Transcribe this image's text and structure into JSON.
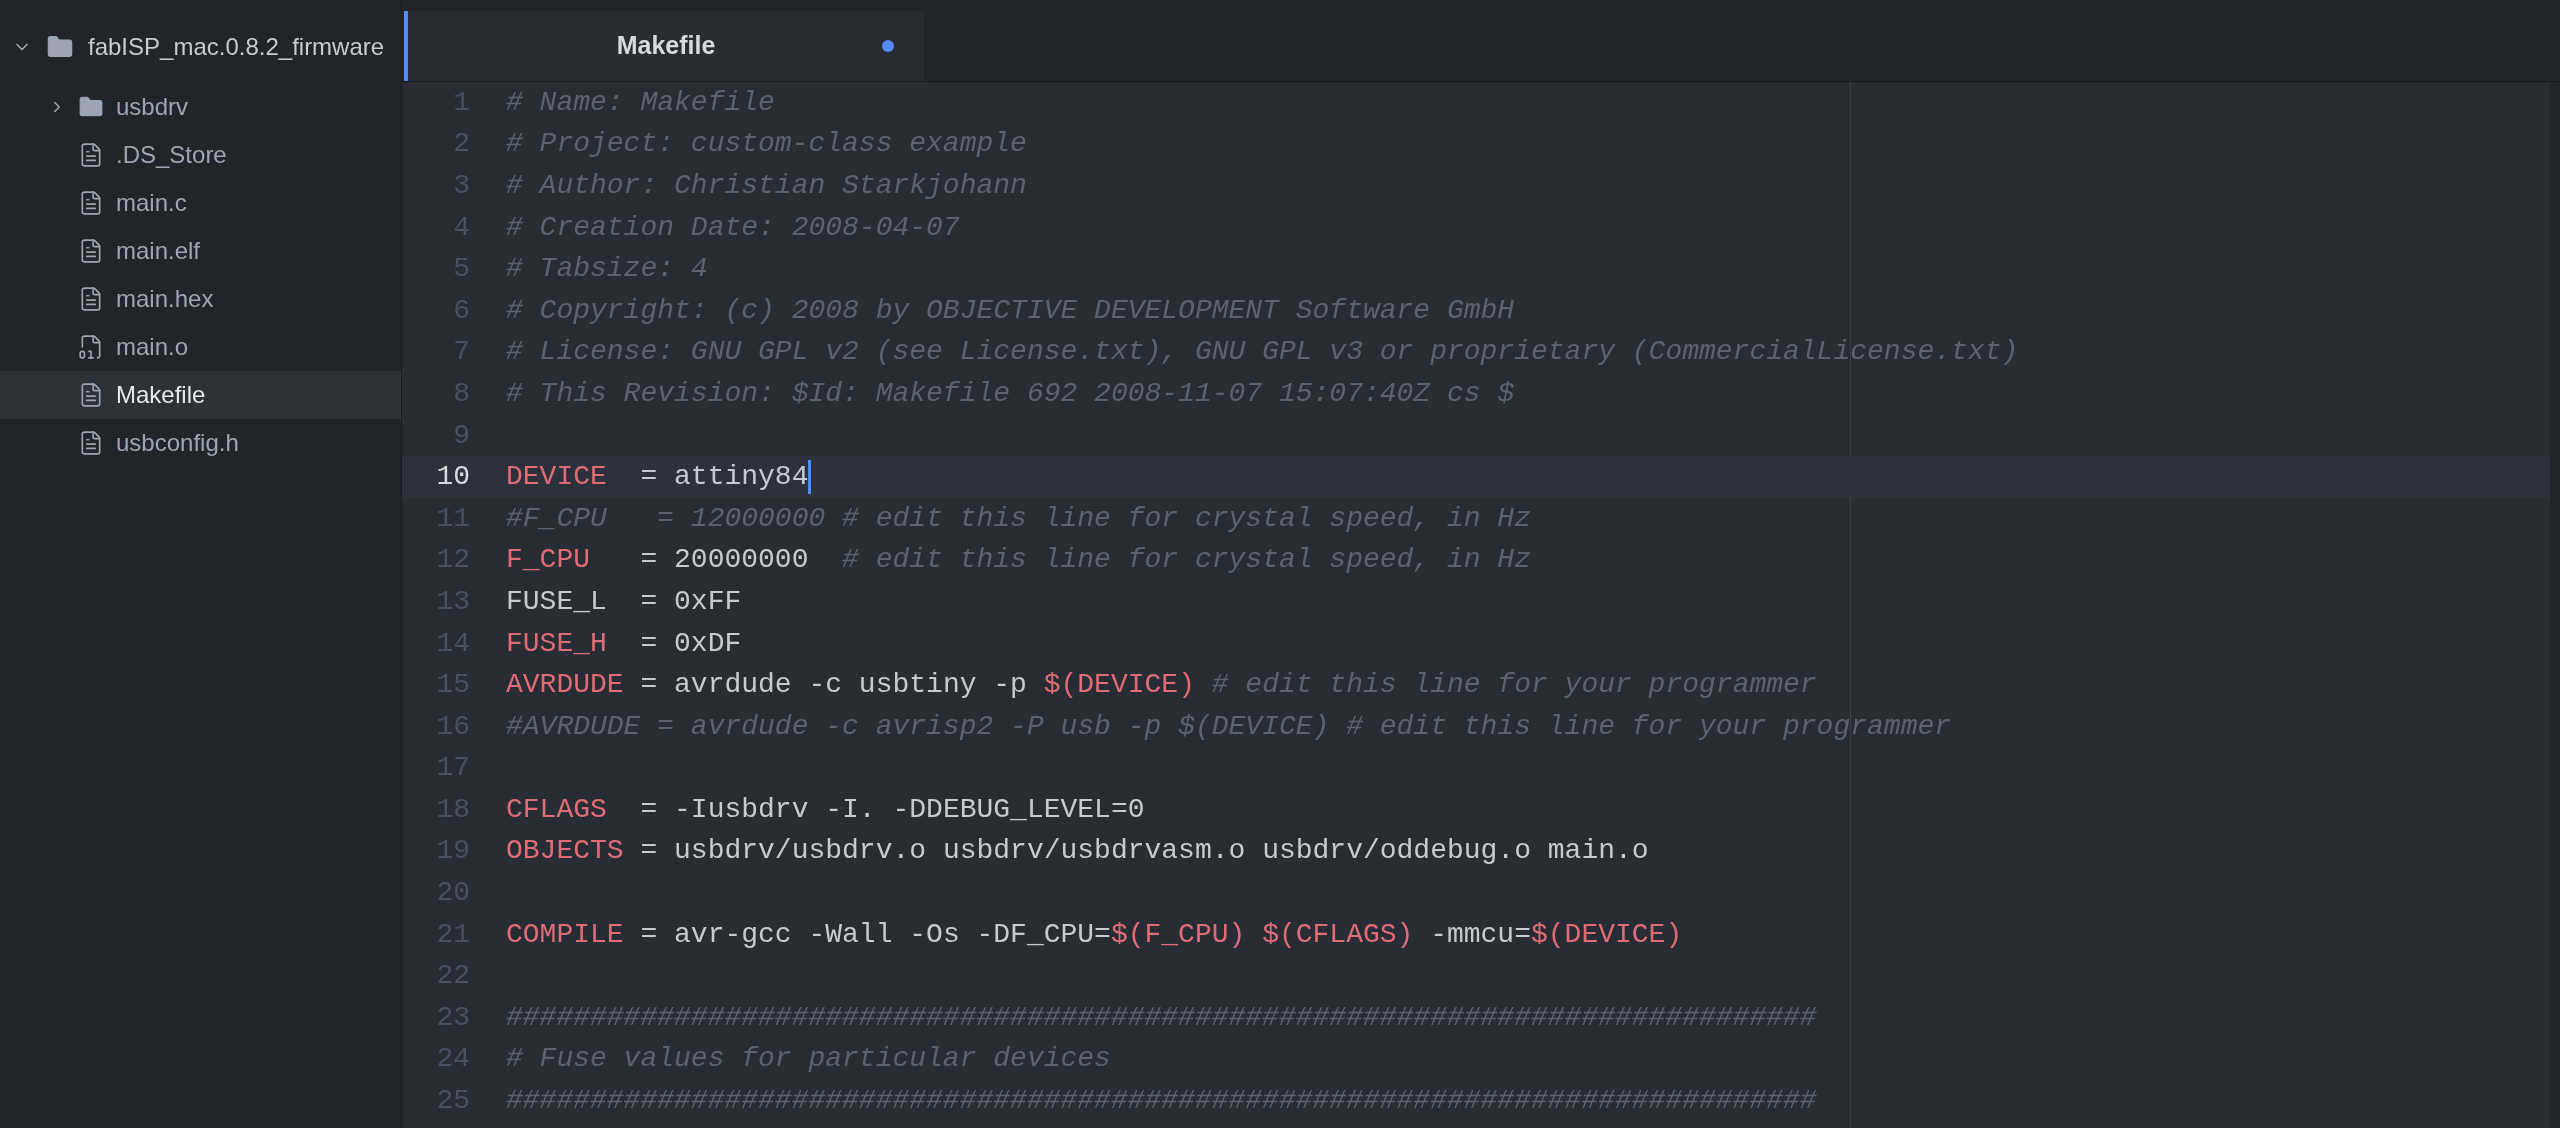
{
  "tree": {
    "label": "fabISP_mac.0.8.2_firmware",
    "expanded": true,
    "children": [
      {
        "kind": "folder",
        "label": "usbdrv",
        "expanded": false,
        "selected": false
      },
      {
        "kind": "file",
        "label": ".DS_Store",
        "selected": false
      },
      {
        "kind": "file",
        "label": "main.c",
        "selected": false
      },
      {
        "kind": "file",
        "label": "main.elf",
        "selected": false
      },
      {
        "kind": "file",
        "label": "main.hex",
        "selected": false
      },
      {
        "kind": "binary",
        "label": "main.o",
        "selected": false
      },
      {
        "kind": "file",
        "label": "Makefile",
        "selected": true
      },
      {
        "kind": "file",
        "label": "usbconfig.h",
        "selected": false
      }
    ]
  },
  "tabs": [
    {
      "label": "Makefile",
      "selected": true,
      "modified": true
    }
  ],
  "lines": [
    {
      "number": "1",
      "current": false,
      "segments": [
        {
          "kind": "comment",
          "text": "# Name: Makefile"
        }
      ]
    },
    {
      "number": "2",
      "current": false,
      "segments": [
        {
          "kind": "comment",
          "text": "# Project: custom-class example"
        }
      ]
    },
    {
      "number": "3",
      "current": false,
      "segments": [
        {
          "kind": "comment",
          "text": "# Author: Christian Starkjohann"
        }
      ]
    },
    {
      "number": "4",
      "current": false,
      "segments": [
        {
          "kind": "comment",
          "text": "# Creation Date: 2008-04-07"
        }
      ]
    },
    {
      "number": "5",
      "current": false,
      "segments": [
        {
          "kind": "comment",
          "text": "# Tabsize: 4"
        }
      ]
    },
    {
      "number": "6",
      "current": false,
      "segments": [
        {
          "kind": "comment",
          "text": "# Copyright: (c) 2008 by OBJECTIVE DEVELOPMENT Software GmbH"
        }
      ]
    },
    {
      "number": "7",
      "current": false,
      "segments": [
        {
          "kind": "comment",
          "text": "# License: GNU GPL v2 (see License.txt), GNU GPL v3 or proprietary (CommercialLicense.txt)"
        }
      ]
    },
    {
      "number": "8",
      "current": false,
      "segments": [
        {
          "kind": "comment",
          "text": "# This Revision: $Id: Makefile 692 2008-11-07 15:07:40Z cs $"
        }
      ]
    },
    {
      "number": "9",
      "current": false
    },
    {
      "number": "10",
      "current": true,
      "segments": [
        {
          "kind": "name",
          "text": "DEVICE"
        },
        {
          "kind": "plain",
          "text": "  = attiny84"
        }
      ]
    },
    {
      "number": "11",
      "current": false,
      "segments": [
        {
          "kind": "comment",
          "text": "#F_CPU   = 12000000 # edit this line for crystal speed, in Hz"
        }
      ]
    },
    {
      "number": "12",
      "current": false,
      "segments": [
        {
          "kind": "name",
          "text": "F_CPU"
        },
        {
          "kind": "plain",
          "text": "   = 20000000  "
        },
        {
          "kind": "comment",
          "text": "# edit this line for crystal speed, in Hz"
        }
      ]
    },
    {
      "number": "13",
      "current": false,
      "segments": [
        {
          "kind": "plain",
          "text": "FUSE_L  = 0xFF"
        }
      ]
    },
    {
      "number": "14",
      "current": false,
      "segments": [
        {
          "kind": "name",
          "text": "FUSE_H"
        },
        {
          "kind": "plain",
          "text": "  = 0xDF"
        }
      ]
    },
    {
      "number": "15",
      "current": false,
      "segments": [
        {
          "kind": "name",
          "text": "AVRDUDE"
        },
        {
          "kind": "plain",
          "text": " = avrdude -c usbtiny -p "
        },
        {
          "kind": "ref",
          "text": "$(DEVICE)"
        },
        {
          "kind": "comment",
          "text": " # edit this line for your programmer"
        }
      ]
    },
    {
      "number": "16",
      "current": false,
      "segments": [
        {
          "kind": "comment",
          "text": "#AVRDUDE = avrdude -c avrisp2 -P usb -p $(DEVICE) # edit this line for your programmer"
        }
      ]
    },
    {
      "number": "17",
      "current": false
    },
    {
      "number": "18",
      "current": false,
      "segments": [
        {
          "kind": "name",
          "text": "CFLAGS"
        },
        {
          "kind": "plain",
          "text": "  = -Iusbdrv -I. -DDEBUG_LEVEL=0"
        }
      ]
    },
    {
      "number": "19",
      "current": false,
      "segments": [
        {
          "kind": "name",
          "text": "OBJECTS"
        },
        {
          "kind": "plain",
          "text": " = usbdrv/usbdrv.o usbdrv/usbdrvasm.o usbdrv/oddebug.o main.o"
        }
      ]
    },
    {
      "number": "20",
      "current": false
    },
    {
      "number": "21",
      "current": false,
      "segments": [
        {
          "kind": "name",
          "text": "COMPILE"
        },
        {
          "kind": "plain",
          "text": " = avr-gcc -Wall -Os -DF_CPU="
        },
        {
          "kind": "ref",
          "text": "$(F_CPU) $(CFLAGS)"
        },
        {
          "kind": "plain",
          "text": " -mmcu="
        },
        {
          "kind": "ref",
          "text": "$(DEVICE)"
        }
      ]
    },
    {
      "number": "22",
      "current": false
    },
    {
      "number": "23",
      "current": false,
      "segments": [
        {
          "kind": "comment",
          "text": "##############################################################################"
        }
      ]
    },
    {
      "number": "24",
      "current": false,
      "segments": [
        {
          "kind": "comment",
          "text": "# Fuse values for particular devices"
        }
      ]
    },
    {
      "number": "25",
      "current": false,
      "segments": [
        {
          "kind": "comment",
          "text": "##############################################################################"
        }
      ]
    }
  ]
}
